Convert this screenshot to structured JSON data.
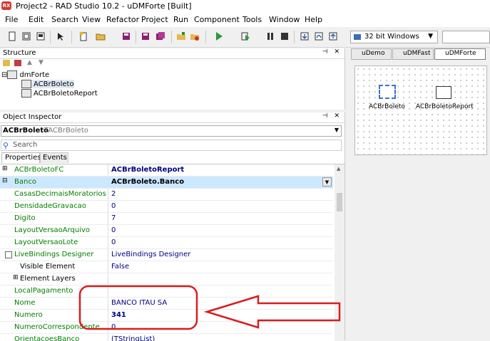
{
  "window": {
    "title": "Project2 - RAD Studio 10.2 - uDMForte [Built]",
    "app_icon": "rad-studio-icon"
  },
  "menu": [
    "File",
    "Edit",
    "Search",
    "View",
    "Refactor",
    "Project",
    "Run",
    "Component",
    "Tools",
    "Window",
    "Help"
  ],
  "toolbar": {
    "platform": "32 bit Windows",
    "icons": [
      "new-file-icon",
      "open-icon",
      "save-all-icon",
      "pointer-icon",
      "new-item-icon",
      "open-project-icon",
      "reopen-icon",
      "save-icon",
      "save-as-icon",
      "add-file-icon",
      "remove-file-icon",
      "run-icon",
      "run-without-debug-icon",
      "pause-icon",
      "stop-icon"
    ]
  },
  "structure": {
    "header": "Structure",
    "tree": [
      {
        "label": "dmForte",
        "level": 0
      },
      {
        "label": "ACBrBoleto",
        "level": 1,
        "selected": true
      },
      {
        "label": "ACBrBoletoReport",
        "level": 1
      }
    ]
  },
  "object_inspector": {
    "header": "Object Inspector",
    "object_name": "ACBrBoleto",
    "object_class": "TACBrBoleto",
    "search_placeholder": "Search",
    "tabs": [
      "Properties",
      "Events"
    ],
    "rows": [
      {
        "name": "ACBrBoletoFC",
        "value": "ACBrBoletoReport",
        "expand": "+",
        "bold_value": true
      },
      {
        "name": "Banco",
        "value": "ACBrBoleto.Banco",
        "expand": "-",
        "selected": true,
        "bold_value": true
      },
      {
        "name": "CasasDecimaisMoratorios",
        "value": "2",
        "indent": 1
      },
      {
        "name": "DensidadeGravacao",
        "value": "0",
        "indent": 1
      },
      {
        "name": "Digito",
        "value": "7",
        "indent": 1
      },
      {
        "name": "LayoutVersaoArquivo",
        "value": "0",
        "indent": 1
      },
      {
        "name": "LayoutVersaoLote",
        "value": "0",
        "indent": 1
      },
      {
        "name": "LiveBindings Designer",
        "value": "LiveBindings Designer",
        "indent": 1,
        "checkbox": true
      },
      {
        "name": "Visible Element",
        "value": "False",
        "indent": 2
      },
      {
        "name": "Element Layers",
        "value": "",
        "indent": 2,
        "expand": "+"
      },
      {
        "name": "LocalPagamento",
        "value": "",
        "indent": 1
      },
      {
        "name": "Nome",
        "value": "BANCO ITAU SA",
        "indent": 1
      },
      {
        "name": "Numero",
        "value": "341",
        "indent": 1,
        "bold_value": true
      },
      {
        "name": "NumeroCorrespondente",
        "value": "0",
        "indent": 1
      },
      {
        "name": "OrientacoesBanco",
        "value": "(TStringList)",
        "indent": 1
      }
    ]
  },
  "designer": {
    "tabs": [
      "uDemo",
      "uDMFast",
      "uDMForte"
    ],
    "components": [
      {
        "label": "ACBrBoleto",
        "selected": true
      },
      {
        "label": "ACBrBoletoReport",
        "selected": false
      }
    ]
  },
  "colors": {
    "annotation": "#d81e1e",
    "property_name": "#008000",
    "property_value": "#000080",
    "selection": "#cce8ff"
  }
}
